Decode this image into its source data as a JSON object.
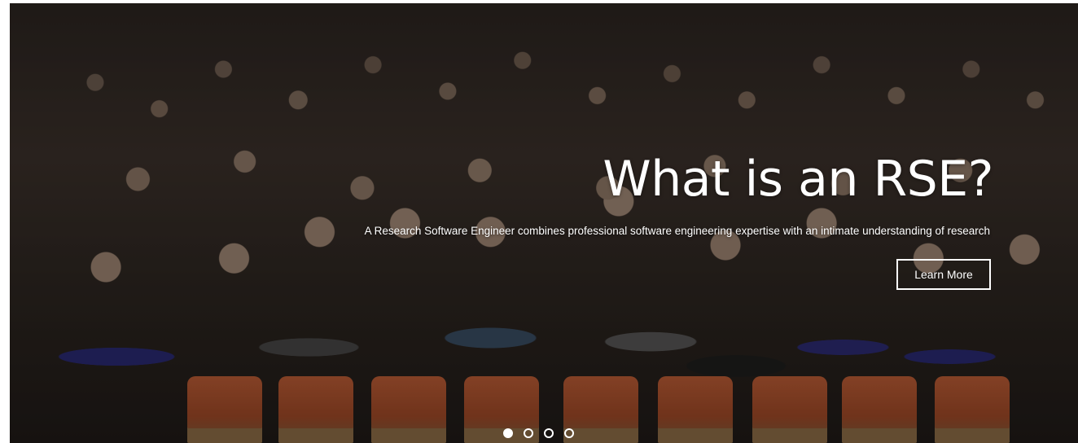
{
  "hero": {
    "image_icon": "crowd-photo",
    "title": "What is an RSE?",
    "subtitle": "A Research Software Engineer combines professional software engineering expertise with an intimate understanding of research",
    "cta_label": "Learn More"
  },
  "carousel": {
    "slide_count": 4,
    "active_index": 0
  },
  "colors": {
    "text": "#ffffff",
    "overlay": "#000000",
    "chair_orange": "#b65a34"
  }
}
